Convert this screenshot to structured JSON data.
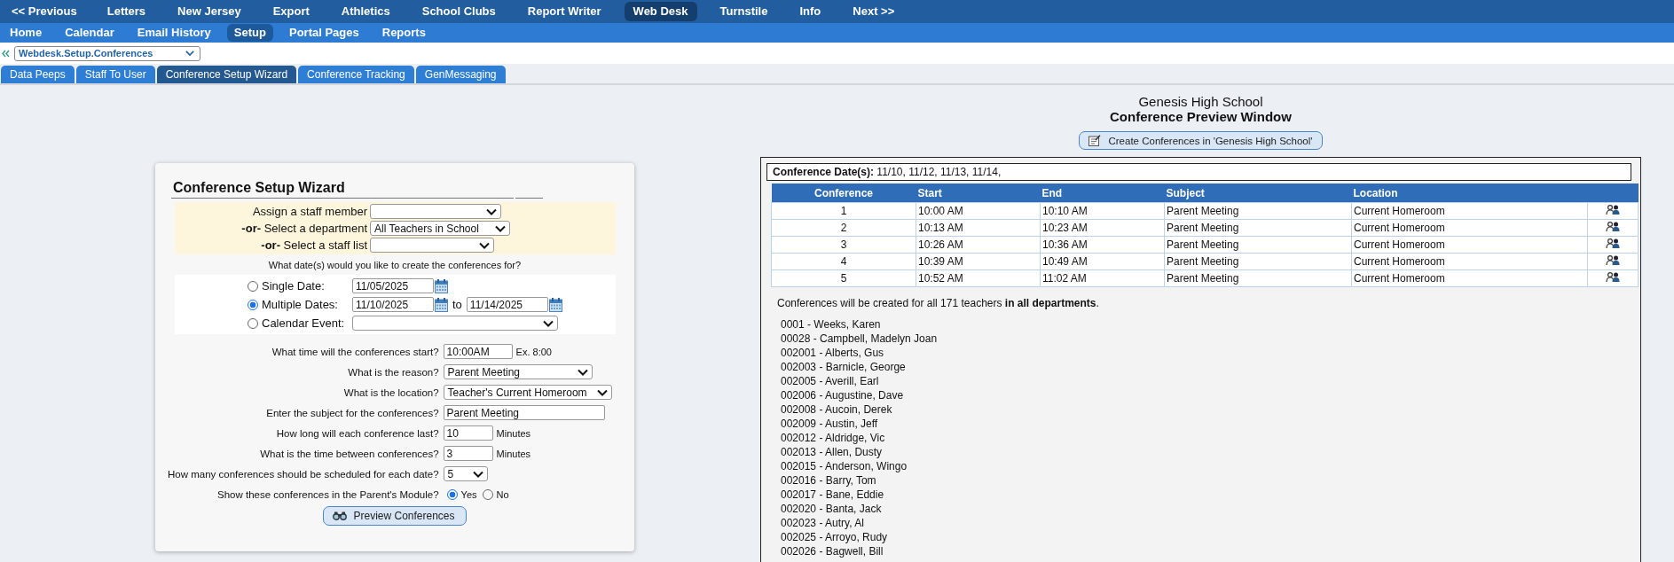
{
  "top_menu": [
    {
      "label": "<< Previous",
      "selected": false
    },
    {
      "label": "Letters",
      "selected": false
    },
    {
      "label": "New Jersey",
      "selected": false
    },
    {
      "label": "Export",
      "selected": false
    },
    {
      "label": "Athletics",
      "selected": false
    },
    {
      "label": "School Clubs",
      "selected": false
    },
    {
      "label": "Report Writer",
      "selected": false
    },
    {
      "label": "Web Desk",
      "selected": true
    },
    {
      "label": "Turnstile",
      "selected": false
    },
    {
      "label": "Info",
      "selected": false
    },
    {
      "label": "Next >>",
      "selected": false
    }
  ],
  "sub_menu": [
    {
      "label": "Home",
      "selected": false
    },
    {
      "label": "Calendar",
      "selected": false
    },
    {
      "label": "Email History",
      "selected": false
    },
    {
      "label": "Setup",
      "selected": true
    },
    {
      "label": "Portal Pages",
      "selected": false
    },
    {
      "label": "Reports",
      "selected": false
    }
  ],
  "page_select": {
    "value": "Webdesk.Setup.Conferences"
  },
  "tabs": [
    {
      "label": "Data Peeps",
      "selected": false
    },
    {
      "label": "Staff To User",
      "selected": false
    },
    {
      "label": "Conference Setup Wizard",
      "selected": true
    },
    {
      "label": "Conference Tracking",
      "selected": false
    },
    {
      "label": "GenMessaging",
      "selected": false
    }
  ],
  "wizard": {
    "title": "Conference Setup Wizard",
    "staff_fields": [
      {
        "label": "Assign a staff member"
      },
      {
        "label": "**-or-** Select a department",
        "value": "All Teachers in School"
      },
      {
        "label": "**-or-** Select a staff list"
      }
    ],
    "date_prompt": "What date(s) would you like to create the conferences for?",
    "date_options": [
      {
        "kind": "single",
        "label": "Single Date:",
        "selected": false,
        "from": "11/05/2025"
      },
      {
        "kind": "range",
        "label": "Multiple Dates:",
        "selected": true,
        "from": "11/10/2025",
        "joiner": "to",
        "to": "11/14/2025"
      },
      {
        "kind": "event",
        "label": "Calendar Event:",
        "selected": false
      }
    ],
    "questions": [
      {
        "kind": "text",
        "label": "What time will the conferences start?",
        "value": "10:00AM",
        "hint": "Ex. 8:00"
      },
      {
        "kind": "select",
        "label": "What is the reason?",
        "value": "Parent Meeting"
      },
      {
        "kind": "select",
        "label": "What is the location?",
        "value": "Teacher's Current Homeroom"
      },
      {
        "kind": "text",
        "label": "Enter the subject for the conferences?",
        "value": "Parent Meeting"
      },
      {
        "kind": "text",
        "label": "How long will each conference last?",
        "value": "10",
        "hint": "Minutes"
      },
      {
        "kind": "text",
        "label": "What is the time between conferences?",
        "value": "3",
        "hint": "Minutes"
      },
      {
        "kind": "select",
        "label": "How many conferences should be scheduled for each date?",
        "value": "5"
      },
      {
        "kind": "radio",
        "label": "Show these conferences in the Parent's Module?",
        "options": [
          {
            "label": "Yes",
            "selected": true
          },
          {
            "label": "No",
            "selected": false
          }
        ]
      }
    ],
    "preview_button": "Preview Conferences"
  },
  "preview": {
    "school": "Genesis High School",
    "title": "Conference Preview Window",
    "create_button": "Create Conferences in 'Genesis High School'",
    "dates": "**Conference Date(s):** 11/10, 11/12, 11/13, 11/14,",
    "columns": [
      "Conference",
      "Start",
      "End",
      "Subject",
      "Location"
    ],
    "rows": [
      [
        "1",
        "10:00 AM",
        "10:10 AM",
        "Parent Meeting",
        "Current Homeroom"
      ],
      [
        "2",
        "10:13 AM",
        "10:23 AM",
        "Parent Meeting",
        "Current Homeroom"
      ],
      [
        "3",
        "10:26 AM",
        "10:36 AM",
        "Parent Meeting",
        "Current Homeroom"
      ],
      [
        "4",
        "10:39 AM",
        "10:49 AM",
        "Parent Meeting",
        "Current Homeroom"
      ],
      [
        "5",
        "10:52 AM",
        "11:02 AM",
        "Parent Meeting",
        "Current Homeroom"
      ]
    ],
    "summary": "Conferences will be created for all 171 teachers **in all departments**.",
    "teachers": [
      "0001 - Weeks, Karen",
      "00028 - Campbell, Madelyn Joan",
      "002001 - Alberts, Gus",
      "002003 - Barnicle, George",
      "002005 - Averill, Earl",
      "002006 - Augustine, Dave",
      "002008 - Aucoin, Derek",
      "002009 - Austin, Jeff",
      "002012 - Aldridge, Vic",
      "002013 - Allen, Dusty",
      "002015 - Anderson, Wingo",
      "002016 - Barry, Tom",
      "002017 - Bane, Eddie",
      "002020 - Banta, Jack",
      "002023 - Autry, Al",
      "002025 - Arroyo, Rudy",
      "002026 - Bagwell, Bill"
    ]
  }
}
